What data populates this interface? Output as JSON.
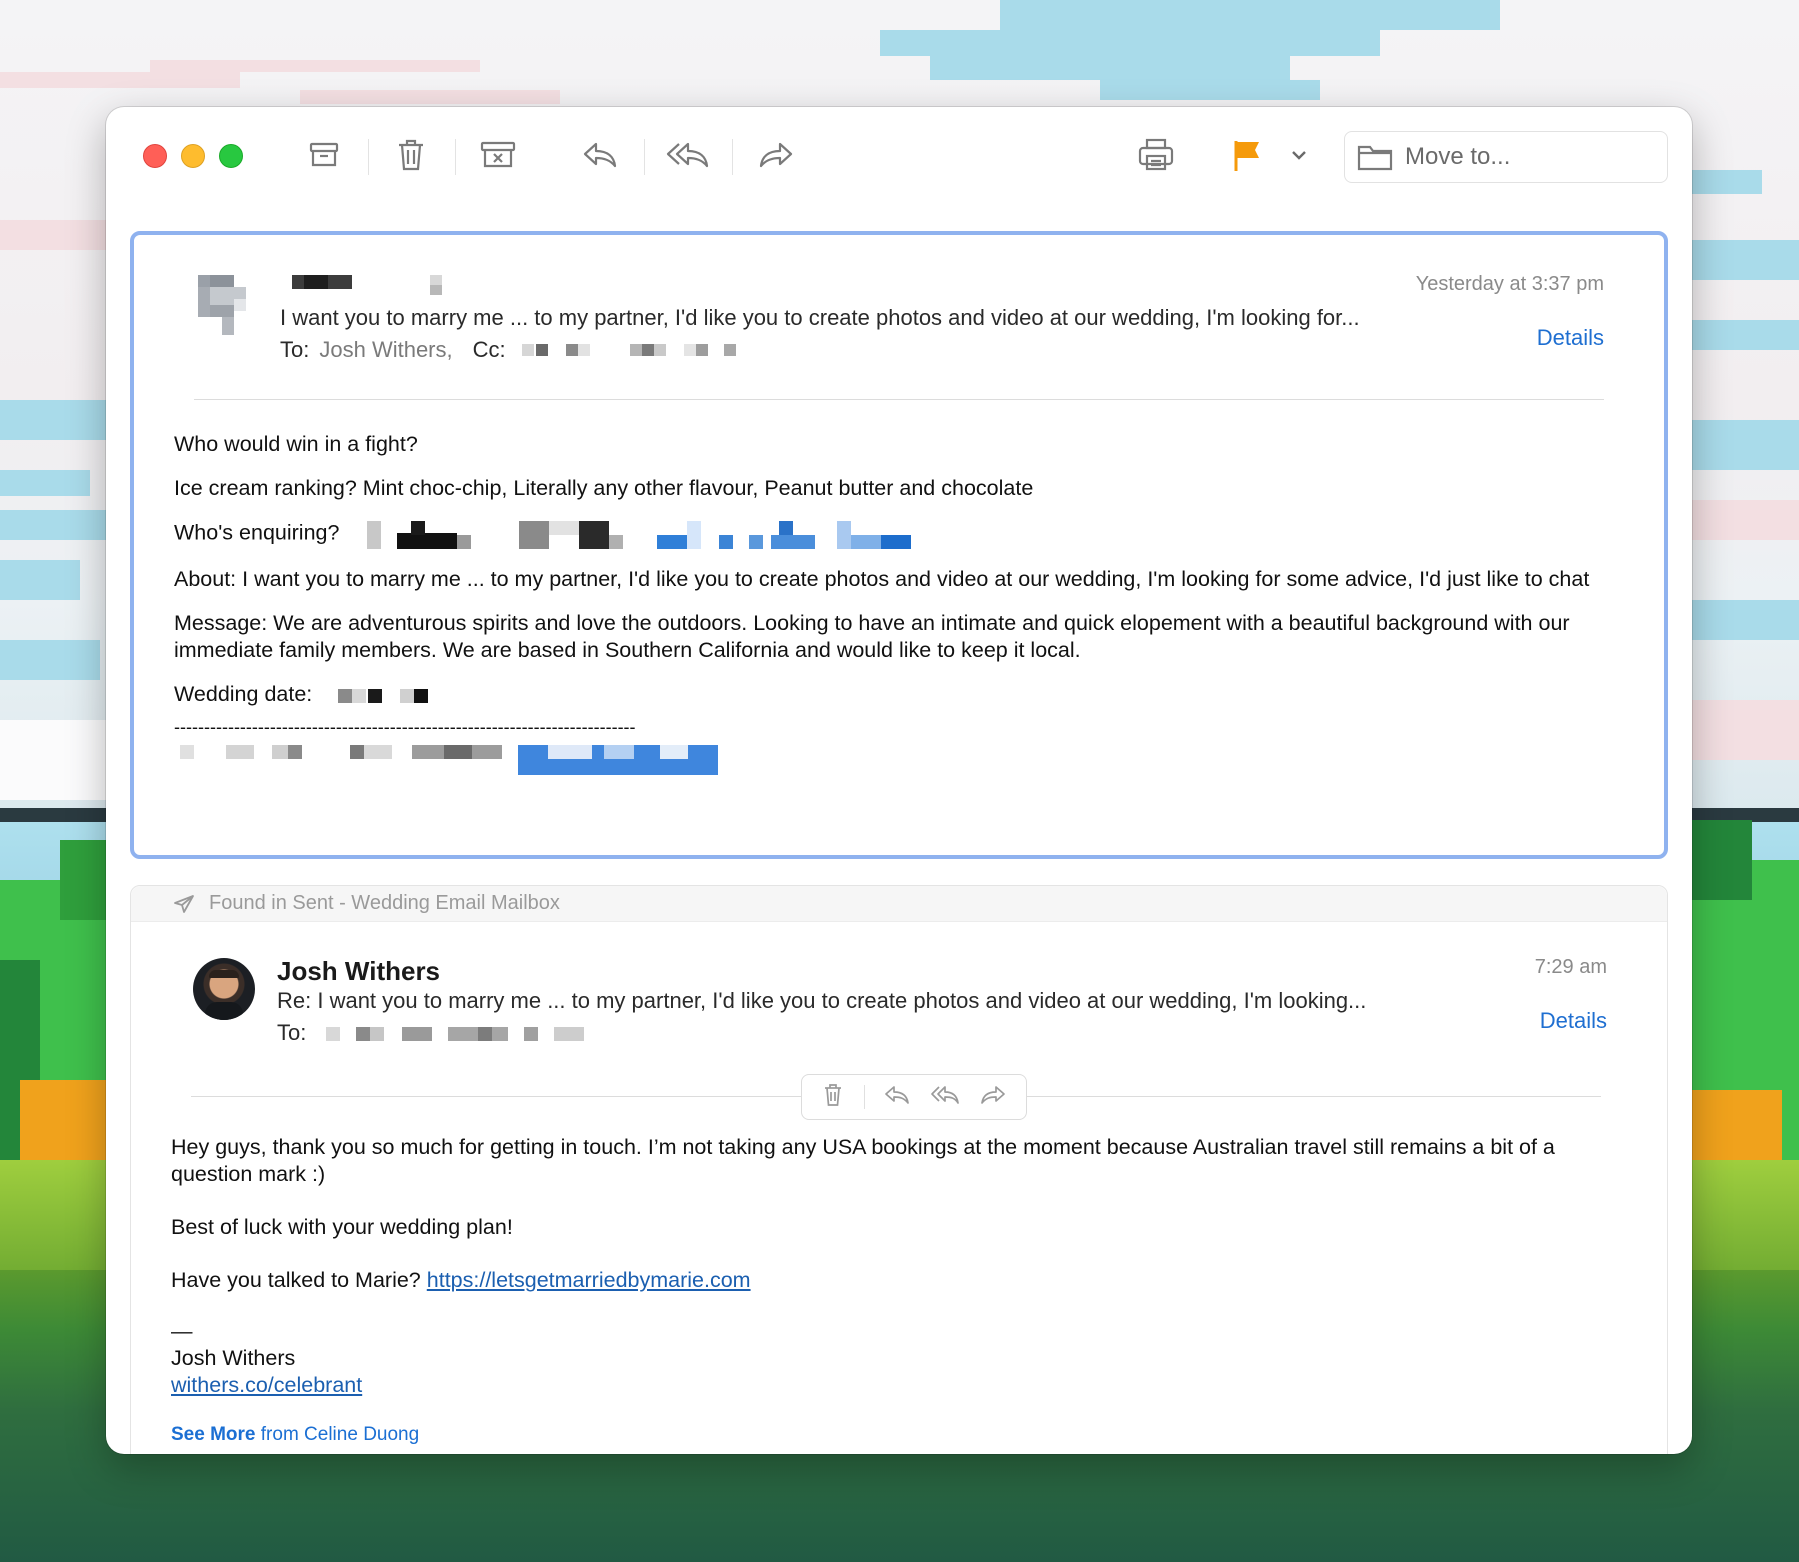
{
  "toolbar": {
    "move_to_label": "Move to..."
  },
  "message1": {
    "date": "Yesterday at 3:37 pm",
    "subject": "I want you to marry me ... to my partner, I'd like you to create photos and video at our wedding, I'm looking for...",
    "to_label": "To:",
    "to_name": "Josh Withers,",
    "cc_label": "Cc:",
    "details_label": "Details",
    "body": {
      "line1": "Who would win in a fight?",
      "line2": "Ice cream ranking? Mint choc-chip, Literally any other flavour, Peanut butter and chocolate",
      "enquiring_label": "Who's enquiring?",
      "about": "About: I want you to marry me ... to my partner, I'd like you to create photos and video at our wedding, I'm looking for some advice, I'd just like to chat",
      "message": "Message: We are adventurous spirits and love the outdoors. Looking to have an intimate and quick elopement with a beautiful background with our immediate family members. We are based in Southern California and would like to keep it local.",
      "wedding_date_label": "Wedding date:",
      "divider": "-----------------------------------------------------------------------------"
    }
  },
  "message2": {
    "found_in": "Found in Sent - Wedding Email Mailbox",
    "sender": "Josh Withers",
    "date": "7:29 am",
    "subject": "Re: I want you to marry me ... to my partner, I'd like you to create photos and video at our wedding, I'm looking...",
    "to_label": "To:",
    "details_label": "Details",
    "body": {
      "para1": "Hey guys, thank you so much for getting in touch. I’m not taking any USA bookings at the moment because Australian travel still remains a bit of a question mark :)",
      "para2": "Best of luck with your wedding plan!",
      "para3_prefix": "Have you talked to Marie?",
      "para3_link": "https://letsgetmarriedbymarie.com",
      "sig_dash": "—",
      "sig_name": "Josh Withers",
      "sig_link": "withers.co/celebrant",
      "see_more_bold": "See More",
      "see_more_rest": "from Celine Duong"
    }
  },
  "colors": {
    "accent_blue": "#1f6fd1",
    "flag_orange": "#f59a0b",
    "selected_border": "#8fb2ef"
  }
}
